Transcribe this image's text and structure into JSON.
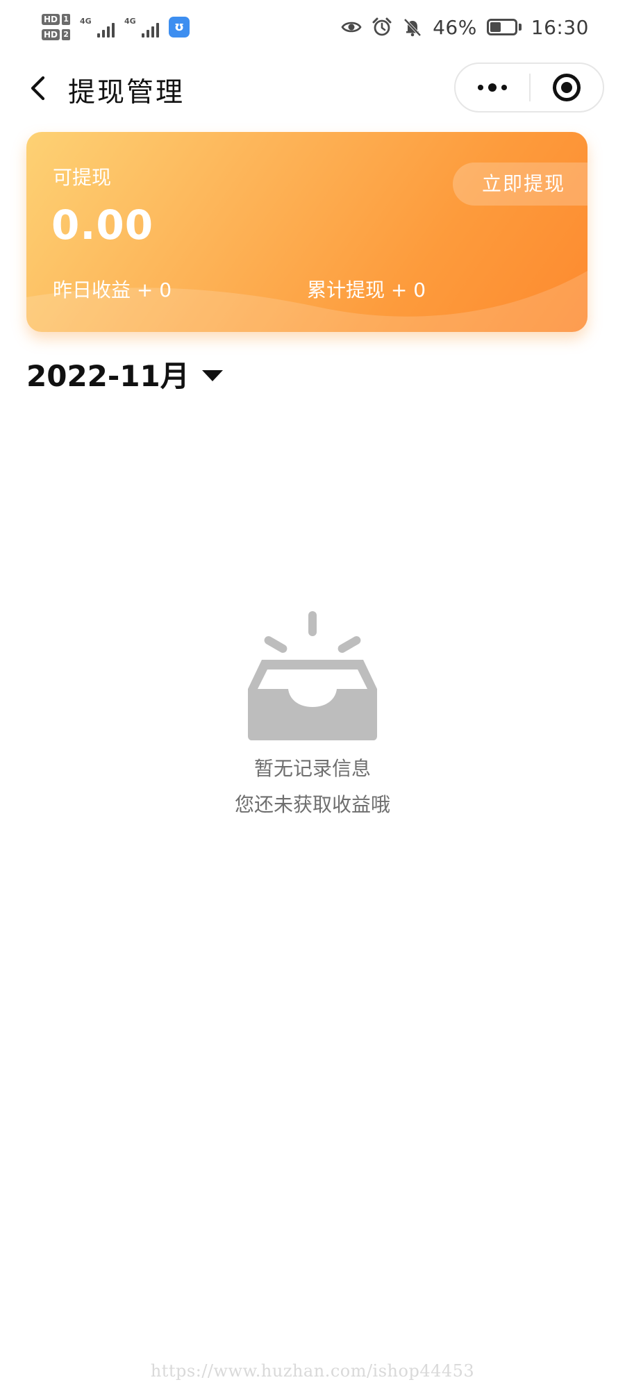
{
  "status_bar": {
    "sim1_badge": "HD",
    "sim1_num": "1",
    "sim2_badge": "HD",
    "sim2_num": "2",
    "network1": "4G",
    "network2": "4G",
    "app_badge_icon": "app-notification-icon",
    "icons": [
      "eye-icon",
      "alarm-icon",
      "bell-mute-icon",
      "battery-icon"
    ],
    "battery_percent_text": "46%",
    "battery_level": 0.46,
    "time": "16:30"
  },
  "nav": {
    "title": "提现管理",
    "back_icon": "back-arrow-icon",
    "more_icon": "more-dots-icon",
    "close_icon": "target-icon"
  },
  "balance_card": {
    "label": "可提现",
    "amount": "0.00",
    "withdraw_button": "立即提现",
    "yesterday_income": "昨日收益 + 0",
    "total_withdrawn": "累计提现 + 0",
    "gradient_colors": [
      "#fdd174",
      "#fd8a2f"
    ]
  },
  "month_picker": {
    "value": "2022-11月",
    "icon": "caret-down-icon"
  },
  "empty_state": {
    "icon": "empty-inbox-icon",
    "title": "暂无记录信息",
    "subtitle": "您还未获取收益哦"
  },
  "watermark": "https://www.huzhan.com/ishop44453"
}
